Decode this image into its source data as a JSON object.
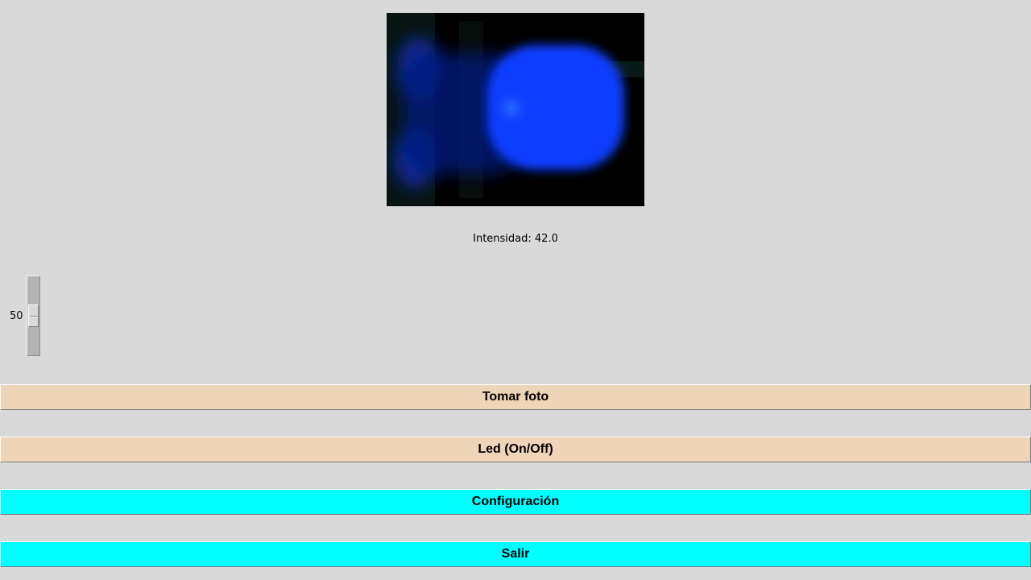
{
  "camera": {
    "image_description_icon": "led-camera-feed",
    "background_color": "#000000",
    "glow_color": "#0a3cff"
  },
  "intensity": {
    "label": "Intensidad: 42.0"
  },
  "slider": {
    "value_label": "50",
    "value": 50,
    "min": 0,
    "max": 100,
    "orientation": "vertical"
  },
  "buttons": {
    "take_photo": {
      "label": "Tomar foto",
      "color": "#eed5b7"
    },
    "led_toggle": {
      "label": "Led (On/Off)",
      "color": "#eed5b7"
    },
    "settings": {
      "label": "Configuración",
      "color": "#00ffff"
    },
    "exit": {
      "label": "Salir",
      "color": "#00ffff"
    }
  }
}
